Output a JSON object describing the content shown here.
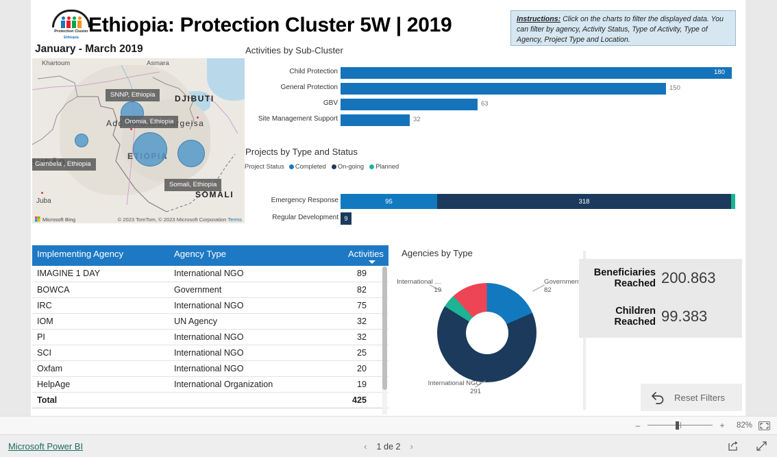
{
  "header": {
    "logo_caption": "Protection Cluster",
    "logo_caption2": "Ethiopia",
    "title": "Ethiopia: Protection Cluster 5W | 2019",
    "subtitle": "January - March 2019"
  },
  "instructions": {
    "label": "Instructions:",
    "text": " Click on the charts to filter the displayed data. You can filter by agency, Activity Status, Type of Activity, Type of Agency, Project Type and Location."
  },
  "map": {
    "tooltips": [
      {
        "label": "SNNP, Ethiopia"
      },
      {
        "label": "Oromia, Ethiopia"
      },
      {
        "label": "Gambela , Ethiopia"
      },
      {
        "label": "Somali, Ethiopia"
      }
    ],
    "place_labels": [
      "Khartoum",
      "Asmara",
      "DJIBUTI",
      "Addis Ababa",
      "Hargeisa",
      "ETIÓPIA",
      "SUDÃO",
      "Juba",
      "SOMÁLI"
    ],
    "bing_text": "Microsoft Bing",
    "attribution": "© 2023 TomTom, © 2023 Microsoft Corporation",
    "terms": "Terms"
  },
  "subcluster_chart": {
    "title": "Activities by Sub-Cluster"
  },
  "projects_chart": {
    "title": "Projects by Type and Status",
    "legend_title": "Project Status"
  },
  "table": {
    "columns": [
      "Implementing Agency",
      "Agency Type",
      "Activities"
    ],
    "rows": [
      {
        "agency": "IMAGINE 1 DAY",
        "type": "International NGO",
        "activities": "89"
      },
      {
        "agency": "BOWCA",
        "type": "Government",
        "activities": "82"
      },
      {
        "agency": "IRC",
        "type": "International NGO",
        "activities": "75"
      },
      {
        "agency": "IOM",
        "type": "UN Agency",
        "activities": "32"
      },
      {
        "agency": "PI",
        "type": "International NGO",
        "activities": "32"
      },
      {
        "agency": "SCI",
        "type": "International NGO",
        "activities": "25"
      },
      {
        "agency": "Oxfam",
        "type": "International NGO",
        "activities": "20"
      },
      {
        "agency": "HelpAge",
        "type": "International Organization",
        "activities": "19"
      }
    ],
    "total_label": "Total",
    "total_value": "425"
  },
  "donut_chart": {
    "title": "Agencies by Type"
  },
  "kpi": [
    {
      "label_line1": "Beneficiaries",
      "label_line2": "Reached",
      "value": "200.863"
    },
    {
      "label_line1": "Children",
      "label_line2": "Reached",
      "value": "99.383"
    }
  ],
  "reset": {
    "label": "Reset Filters"
  },
  "zoombar": {
    "minus": "–",
    "plus": "+",
    "percent": "82%"
  },
  "footer": {
    "brand": "Microsoft Power BI",
    "page_text": "1 de 2",
    "prev": "‹",
    "next": "›"
  },
  "colors": {
    "completed_blue": "#1279bf",
    "ongoing_navy": "#1b3a5c",
    "planned_teal": "#1cb494",
    "bar_blue": "#1573bb",
    "header_blue": "#1e79c4",
    "donut_red": "#ed4556",
    "bubble_blue": "#5297c9"
  },
  "chart_data": [
    {
      "type": "bar",
      "title": "Activities by Sub-Cluster",
      "orientation": "horizontal",
      "categories": [
        "Child Protection",
        "General Protection",
        "GBV",
        "Site Management Support"
      ],
      "values": [
        180,
        150,
        63,
        32
      ],
      "xlabel": "",
      "ylabel": "",
      "xlim": [
        0,
        180
      ],
      "grid": false,
      "legend": "none"
    },
    {
      "type": "bar",
      "title": "Projects by Type and Status",
      "orientation": "horizontal",
      "stacked": true,
      "legend_title": "Project Status",
      "legend": [
        "Completed",
        "On-going",
        "Planned"
      ],
      "legend_position": "top-left",
      "categories": [
        "Emergency Response",
        "Regular Development"
      ],
      "series": [
        {
          "name": "Completed",
          "values": [
            95,
            0
          ],
          "color": "#1279bf"
        },
        {
          "name": "On-going",
          "values": [
            318,
            9
          ],
          "color": "#1b3a5c"
        },
        {
          "name": "Planned",
          "values": [
            4,
            0
          ],
          "color": "#1cb494"
        }
      ],
      "grid": false
    },
    {
      "type": "pie",
      "subtype": "donut",
      "title": "Agencies by Type",
      "categories": [
        "Government",
        "International NGO",
        "International Organization",
        "UN Agency"
      ],
      "values": [
        82,
        291,
        19,
        38
      ],
      "labels_shown": [
        "Government\n82",
        "International NGO\n291",
        "International ...\n19"
      ],
      "colors": [
        "#1279bf",
        "#1b3a5c",
        "#1cb494",
        "#ed4556"
      ],
      "legend": "none"
    },
    {
      "type": "table",
      "title": "Implementing Agency",
      "columns": [
        "Implementing Agency",
        "Agency Type",
        "Activities"
      ],
      "rows": [
        [
          "IMAGINE 1 DAY",
          "International NGO",
          89
        ],
        [
          "BOWCA",
          "Government",
          82
        ],
        [
          "IRC",
          "International NGO",
          75
        ],
        [
          "IOM",
          "UN Agency",
          32
        ],
        [
          "PI",
          "International NGO",
          32
        ],
        [
          "SCI",
          "International NGO",
          25
        ],
        [
          "Oxfam",
          "International NGO",
          20
        ],
        [
          "HelpAge",
          "International Organization",
          19
        ]
      ],
      "total": [
        "Total",
        "",
        425
      ]
    }
  ]
}
